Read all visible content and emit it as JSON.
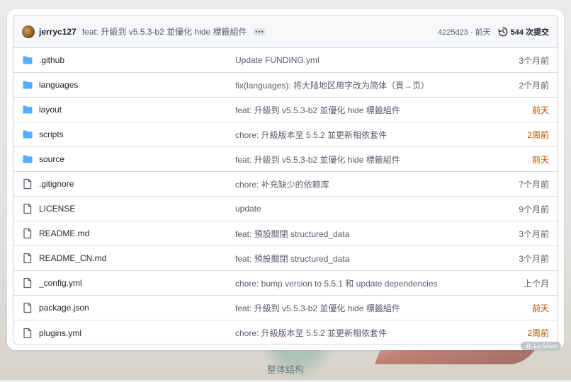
{
  "commit": {
    "author": "jerryc127",
    "message": "feat: 升級到 v5.5.3-b2 並優化 hide 標籤組件",
    "ellipsis": "•••",
    "hash_time": "4225d23 · 前天",
    "commit_count": "544 次提交"
  },
  "files": [
    {
      "name": ".github",
      "type": "folder",
      "message": "Update FUNDING.yml",
      "time": "3个月前",
      "recent": false
    },
    {
      "name": "languages",
      "type": "folder",
      "message": "fix(languages): 将大陆地区用字改为简体（頁→页）",
      "time": "2个月前",
      "recent": false
    },
    {
      "name": "layout",
      "type": "folder",
      "message": "feat: 升級到 v5.5.3-b2 並優化 hide 標籤組件",
      "time": "前天",
      "recent": true
    },
    {
      "name": "scripts",
      "type": "folder",
      "message": "chore: 升級版本至 5.5.2 並更新相依套件",
      "time": "2周前",
      "recent": true
    },
    {
      "name": "source",
      "type": "folder",
      "message": "feat: 升級到 v5.5.3-b2 並優化 hide 標籤組件",
      "time": "前天",
      "recent": true
    },
    {
      "name": ".gitignore",
      "type": "file",
      "message": "chore: 补充缺少的依赖库",
      "time": "7个月前",
      "recent": false
    },
    {
      "name": "LICENSE",
      "type": "file",
      "message": "update",
      "time": "9个月前",
      "recent": false
    },
    {
      "name": "README.md",
      "type": "file",
      "message": "feat: 預設關閉 structured_data",
      "time": "3个月前",
      "recent": false
    },
    {
      "name": "README_CN.md",
      "type": "file",
      "message": "feat: 預設關閉 structured_data",
      "time": "3个月前",
      "recent": false
    },
    {
      "name": "_config.yml",
      "type": "file",
      "message": "chore: bump version to 5.5.1 和 update dependencies",
      "time": "上个月",
      "recent": false
    },
    {
      "name": "package.json",
      "type": "file",
      "message": "feat: 升級到 v5.5.3-b2 並優化 hide 標籤組件",
      "time": "前天",
      "recent": true
    },
    {
      "name": "plugins.yml",
      "type": "file",
      "message": "chore: 升級版本至 5.5.2 並更新相依套件",
      "time": "2周前",
      "recent": true
    }
  ],
  "watermark": "@ LiuShen",
  "caption": "整体结构",
  "colors": {
    "folder": "#54aeff",
    "file_icon": "#57606a",
    "recent_time": "#bc4c00"
  }
}
